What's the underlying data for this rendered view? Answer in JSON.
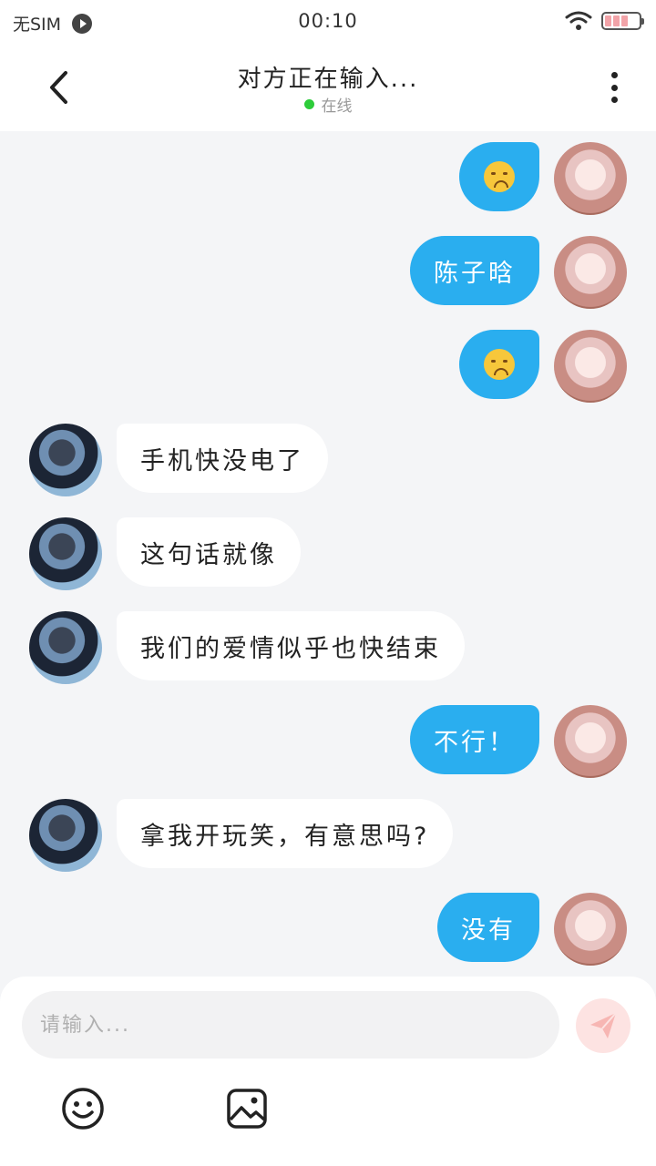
{
  "status_bar": {
    "carrier": "无SIM",
    "time": "00:10"
  },
  "header": {
    "title": "对方正在输入...",
    "status": "在线"
  },
  "messages": [
    {
      "from": "me",
      "type": "emoji",
      "emoji": "disappointed-face"
    },
    {
      "from": "me",
      "type": "text",
      "text": "陈子晗"
    },
    {
      "from": "me",
      "type": "emoji",
      "emoji": "pensive-face"
    },
    {
      "from": "other",
      "type": "text",
      "text": "手机快没电了"
    },
    {
      "from": "other",
      "type": "text",
      "text": "这句话就像"
    },
    {
      "from": "other",
      "type": "text",
      "text": "我们的爱情似乎也快结束"
    },
    {
      "from": "me",
      "type": "text",
      "text": "不行！"
    },
    {
      "from": "other",
      "type": "text",
      "text": "拿我开玩笑，有意思吗?"
    },
    {
      "from": "me",
      "type": "text",
      "text": "没有"
    }
  ],
  "composer": {
    "placeholder": "请输入...",
    "value": ""
  },
  "colors": {
    "my_bubble": "#2aaeef",
    "other_bubble": "#ffffff",
    "online_dot": "#2dcc3a",
    "send_button": "#fde3e2",
    "background": "#f4f5f7"
  },
  "icons": [
    "back-arrow-icon",
    "more-vertical-icon",
    "send-icon",
    "emoji-icon",
    "image-icon",
    "wifi-icon",
    "battery-icon",
    "media-play-icon"
  ]
}
